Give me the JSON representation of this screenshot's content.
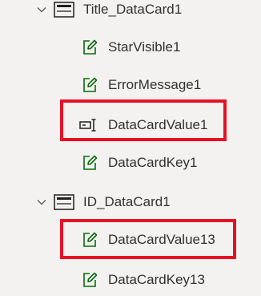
{
  "tree": {
    "groups": [
      {
        "label": "Title_DataCard1",
        "icon": "datacard-icon",
        "expanded": true,
        "children": [
          {
            "label": "StarVisible1",
            "icon": "edit-icon",
            "highlighted": false
          },
          {
            "label": "ErrorMessage1",
            "icon": "edit-icon",
            "highlighted": false
          },
          {
            "label": "DataCardValue1",
            "icon": "text-input-icon",
            "highlighted": true
          },
          {
            "label": "DataCardKey1",
            "icon": "edit-icon",
            "highlighted": false
          }
        ]
      },
      {
        "label": "ID_DataCard1",
        "icon": "datacard-icon",
        "expanded": true,
        "children": [
          {
            "label": "DataCardValue13",
            "icon": "edit-icon",
            "highlighted": true
          },
          {
            "label": "DataCardKey13",
            "icon": "edit-icon",
            "highlighted": false
          }
        ]
      }
    ]
  },
  "colors": {
    "background": "#f3f2f1",
    "text": "#323130",
    "icon": "#201f1e",
    "edit_icon": "#0b6a0b",
    "highlight": "#e81123"
  }
}
